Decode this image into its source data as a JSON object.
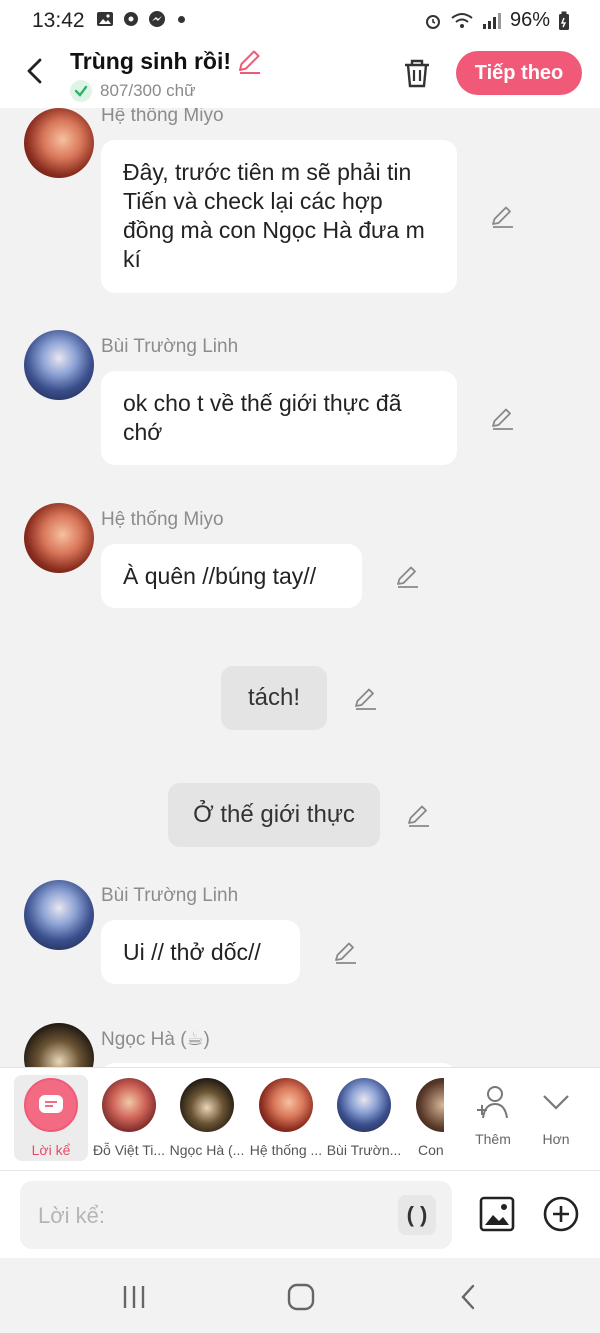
{
  "status_bar": {
    "time": "13:42",
    "battery": "96%"
  },
  "header": {
    "title": "Trùng sinh rồi!",
    "word_count": "807/300 chữ",
    "next_button": "Tiếp theo"
  },
  "messages": [
    {
      "sender": "Hệ thống Miyo",
      "text": "Đây, trước tiên m sẽ phải tin Tiến và check lại các hợp đồng mà con Ngọc Hà đưa m kí"
    },
    {
      "sender": "Bùi Trường Linh",
      "text": "ok cho t về thế giới thực đã chớ"
    },
    {
      "sender": "Hệ thống Miyo",
      "text": "À quên //búng tay//"
    },
    {
      "narration": "tách!"
    },
    {
      "narration": "Ở thế giới thực"
    },
    {
      "sender": "Bùi Trường Linh",
      "text": "Ui // thở dốc//"
    },
    {
      "sender": "Ngọc Hà (☕)",
      "text": ""
    }
  ],
  "characters": [
    {
      "label": "Lời kể",
      "icon": "narrator-icon",
      "selected": true
    },
    {
      "label": "Đỗ Việt Ti..."
    },
    {
      "label": "Ngọc Hà (..."
    },
    {
      "label": "Hệ thống ..."
    },
    {
      "label": "Bùi Trườn..."
    },
    {
      "label": "Con"
    }
  ],
  "more_actions": {
    "add_label": "Thêm",
    "more_label": "Hơn"
  },
  "input": {
    "placeholder": "Lời kể:",
    "paren_button": "( )"
  },
  "colors": {
    "accent": "#f05a78",
    "narrator": "#f26b83",
    "bubble": "#ffffff",
    "narration_bg": "#e4e4e4"
  }
}
